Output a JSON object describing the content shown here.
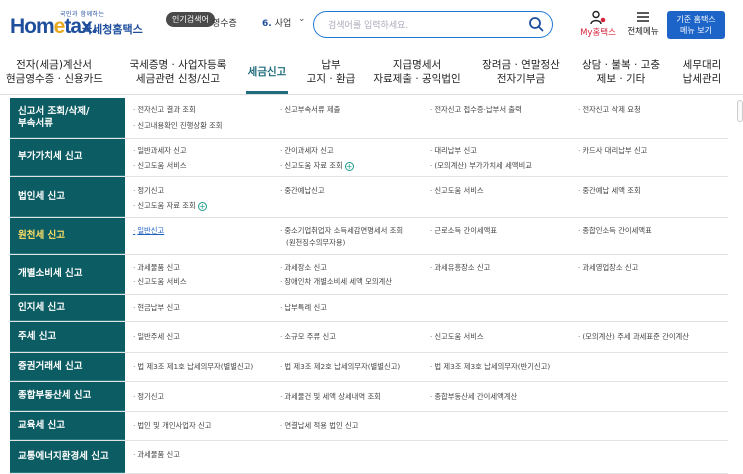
{
  "header": {
    "logo_sub": "국민과 함께하는",
    "logo_home_a": "Hom",
    "logo_home_e": "e",
    "logo_home_b": "tax.",
    "logo_kr": "국세청홈택스",
    "popular_label": "인기검색어",
    "popular_item": "영수증",
    "popular_rank": "6.",
    "popular_term": "사업",
    "search_placeholder": "검색어를 입력하세요.",
    "my_label": "My홈택스",
    "menu_label": "전체메뉴",
    "view_line1": "기준 홈택스",
    "view_line2": "메뉴 보기"
  },
  "nav": [
    {
      "l1": "전자(세금)계산서",
      "l2": "현금영수증 · 신용카드"
    },
    {
      "l1": "국세증명 · 사업자등록",
      "l2": "세금관련 신청/신고"
    },
    {
      "l1": "세금신고",
      "l2": ""
    },
    {
      "l1": "납부",
      "l2": "고지 · 환급"
    },
    {
      "l1": "지급명세서",
      "l2": "자료제출 · 공익법인"
    },
    {
      "l1": "장려금 · 연말정산",
      "l2": "전자기부금"
    },
    {
      "l1": "상담 · 불복 · 고충",
      "l2": "제보 · 기타"
    },
    {
      "l1": "세무대리",
      "l2": "납세관리"
    }
  ],
  "rows": [
    {
      "cat": [
        "신고서 조회/삭제/",
        "부속서류"
      ],
      "cells": [
        {
          "text": "전자신고 결과 조회"
        },
        {
          "text": "신고부속서류 제출"
        },
        {
          "text": "전자신고 접수증·납부서 출력"
        },
        {
          "text": "전자신고 삭제 요청"
        },
        {
          "text": "신고내용확인 진행상황 조회"
        }
      ]
    },
    {
      "cat": [
        "부가가치세 신고"
      ],
      "cells": [
        {
          "text": "일반과세자 신고"
        },
        {
          "text": "간이과세자 신고"
        },
        {
          "text": "대리납부 신고"
        },
        {
          "text": "카드사 대리납부 신고"
        },
        {
          "text": "신고도움 서비스"
        },
        {
          "text": "신고도움 자료 조회"
        },
        {
          "text": "(모의계산) 부가가치세 세액비교"
        }
      ]
    },
    {
      "cat": [
        "법인세 신고"
      ],
      "cells": [
        {
          "text": "정기신고"
        },
        {
          "text": "중간예납신고"
        },
        {
          "text": "신고도움 서비스"
        },
        {
          "text": "중간예납 세액 조회"
        },
        {
          "text": "신고도움 자료 조회"
        }
      ]
    },
    {
      "cat": [
        "원천세 신고"
      ],
      "cells": [
        {
          "text": "일반신고"
        },
        {
          "text": "중소기업취업자 소득세감면명세서 조회"
        },
        {
          "text": "(원천징수의무자용)"
        },
        {
          "text": "근로소득 간이세액표"
        },
        {
          "text": "종합인소득 간이세액표"
        }
      ]
    },
    {
      "cat": [
        "개별소비세 신고"
      ],
      "cells": [
        {
          "text": "과세물품 신고"
        },
        {
          "text": "과세장소 신고"
        },
        {
          "text": "과세유흥장소 신고"
        },
        {
          "text": "과세영업장소 신고"
        },
        {
          "text": "신고도움 서비스"
        },
        {
          "text": "장애인차 개별소비세 세액 모의계산"
        }
      ]
    },
    {
      "cat": [
        "인지세 신고"
      ],
      "cells": [
        {
          "text": "현금납부 신고"
        },
        {
          "text": "납부특례 신고"
        }
      ]
    },
    {
      "cat": [
        "주세 신고"
      ],
      "cells": [
        {
          "text": "일반주세 신고"
        },
        {
          "text": "소규모 주류 신고"
        },
        {
          "text": "신고도움 서비스"
        },
        {
          "text": "(모의계산) 주세 과세표준 간이계산"
        }
      ]
    },
    {
      "cat": [
        "증권거래세 신고"
      ],
      "cells": [
        {
          "text": "법 제3조 제1호 납세의무자(별별신고)"
        },
        {
          "text": "법 제3조 제2호 납세의무자(별별신고)"
        },
        {
          "text": "법 제3조 제3호 납세의무자(반기신고)"
        }
      ]
    },
    {
      "cat": [
        "종합부동산세 신고"
      ],
      "cells": [
        {
          "text": "정기신고"
        },
        {
          "text": "과세물건 및 세액 상세내역 조회"
        },
        {
          "text": "종합부동산세 간이세액계산"
        }
      ]
    },
    {
      "cat": [
        "교육세 신고"
      ],
      "cells": [
        {
          "text": "법인 및 개인사업자 신고"
        },
        {
          "text": "연결납세 적용 법인 신고"
        }
      ]
    },
    {
      "cat": [
        "교통에너지환경세 신고"
      ],
      "cells": [
        {
          "text": "과세물품 신고"
        }
      ]
    }
  ],
  "colors": {
    "category_bg": "#0c5d63",
    "active_text": "#ffe066",
    "accent_blue": "#1c64c8",
    "nav_active": "#1f6c7c"
  }
}
